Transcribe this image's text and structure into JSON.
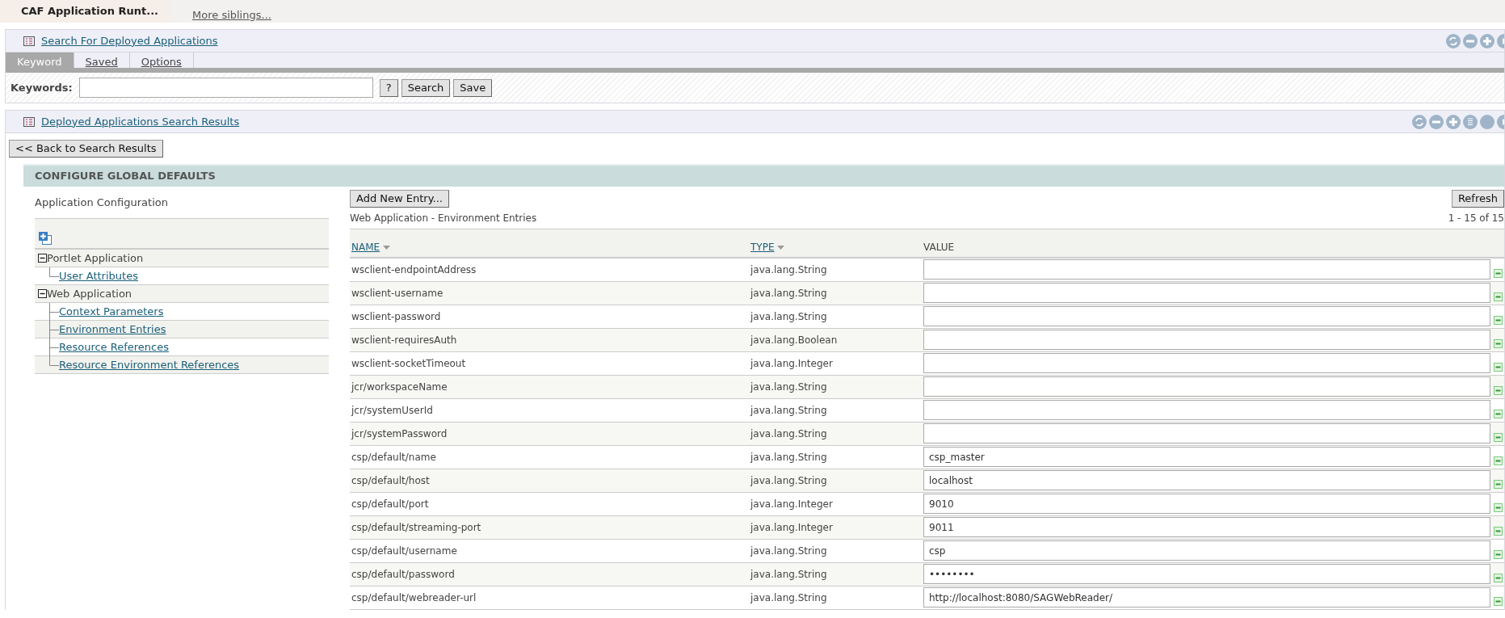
{
  "top_bar": {
    "active_tab": "CAF Application Runt...",
    "link": "More siblings..."
  },
  "search_panel": {
    "title": "Search For Deployed Applications",
    "tabs": [
      {
        "label": "Keyword",
        "selected": true
      },
      {
        "label": "Saved",
        "selected": false
      },
      {
        "label": "Options",
        "selected": false
      }
    ],
    "keywords_label": "Keywords:",
    "help_button": "?",
    "search_button": "Search",
    "save_button": "Save"
  },
  "results_panel": {
    "title": "Deployed Applications Search Results",
    "back_button": "<< Back to Search Results"
  },
  "section_title": "CONFIGURE GLOBAL DEFAULTS",
  "sidebar": {
    "title": "Application Configuration",
    "items": [
      {
        "label": "Portlet Application",
        "expanded": true,
        "children": [
          {
            "label": "User Attributes"
          }
        ]
      },
      {
        "label": "Web Application",
        "expanded": true,
        "children": [
          {
            "label": "Context Parameters"
          },
          {
            "label": "Environment Entries"
          },
          {
            "label": "Resource References"
          },
          {
            "label": "Resource Environment References"
          }
        ]
      }
    ]
  },
  "add_button": "Add New Entry...",
  "refresh_button": "Refresh",
  "table_title": "Web Application - Environment Entries",
  "pagination": "1 - 15 of 15",
  "table": {
    "columns": [
      {
        "label": "NAME",
        "sortable": true
      },
      {
        "label": "TYPE",
        "sortable": true
      },
      {
        "label": "VALUE",
        "sortable": false
      }
    ],
    "rows": [
      {
        "name": "wsclient-endpointAddress",
        "type": "java.lang.String",
        "value": ""
      },
      {
        "name": "wsclient-username",
        "type": "java.lang.String",
        "value": ""
      },
      {
        "name": "wsclient-password",
        "type": "java.lang.String",
        "value": ""
      },
      {
        "name": "wsclient-requiresAuth",
        "type": "java.lang.Boolean",
        "value": ""
      },
      {
        "name": "wsclient-socketTimeout",
        "type": "java.lang.Integer",
        "value": ""
      },
      {
        "name": "jcr/workspaceName",
        "type": "java.lang.String",
        "value": ""
      },
      {
        "name": "jcr/systemUserId",
        "type": "java.lang.String",
        "value": ""
      },
      {
        "name": "jcr/systemPassword",
        "type": "java.lang.String",
        "value": ""
      },
      {
        "name": "csp/default/name",
        "type": "java.lang.String",
        "value": "csp_master"
      },
      {
        "name": "csp/default/host",
        "type": "java.lang.String",
        "value": "localhost"
      },
      {
        "name": "csp/default/port",
        "type": "java.lang.Integer",
        "value": "9010"
      },
      {
        "name": "csp/default/streaming-port",
        "type": "java.lang.Integer",
        "value": "9011"
      },
      {
        "name": "csp/default/username",
        "type": "java.lang.String",
        "value": "csp"
      },
      {
        "name": "csp/default/password",
        "type": "java.lang.String",
        "value": "••••••••"
      },
      {
        "name": "csp/default/webreader-url",
        "type": "java.lang.String",
        "value": "http://localhost:8080/SAGWebReader/"
      }
    ]
  }
}
